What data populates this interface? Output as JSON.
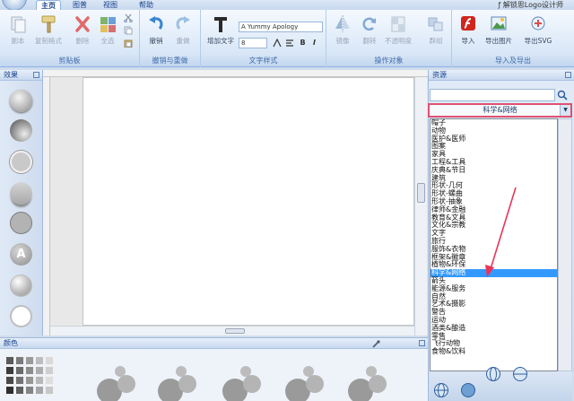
{
  "app": {
    "title": "ƒ 解锁思Logo设计师"
  },
  "tabs": [
    {
      "label": "主页",
      "active": true
    },
    {
      "label": "图普",
      "active": false
    },
    {
      "label": "视图",
      "active": false
    },
    {
      "label": "帮助",
      "active": false
    }
  ],
  "ribbon": {
    "clipboard": {
      "label": "剪贴板",
      "copy": "副本",
      "copy_format": "复制格式",
      "delete": "删除",
      "select_all": "全选"
    },
    "undo_redo": {
      "label": "撤销与重做",
      "undo": "撤销",
      "redo": "重做"
    },
    "text_style": {
      "label": "文字样式",
      "add_text": "增加文字",
      "font_name": "A Yummy Apology",
      "font_size": "8",
      "bold": "B",
      "italic": "I"
    },
    "actions": {
      "label": "操作对象",
      "mirror": "镜像",
      "rotate": "翻转",
      "opacity": "不透明度",
      "group": "群组"
    },
    "import_export": {
      "label": "导入及导出",
      "import": "导入",
      "export_image": "导出图片",
      "export_svg": "导出SVG"
    }
  },
  "effects_panel": {
    "title": "效果",
    "text_effect_glyph": "A"
  },
  "colors_panel": {
    "title": "颜色"
  },
  "resource_panel": {
    "title": "资源",
    "search_placeholder": "",
    "selected_category": "科学&网络",
    "categories": [
      "帽子",
      "动物",
      "医护&医师",
      "图案",
      "家具",
      "工程&工具",
      "庆典&节日",
      "建筑",
      "形状-几何",
      "形状-螺曲",
      "形状-抽象",
      "律师&金融",
      "教育&文具",
      "文化&宗教",
      "文字",
      "旅行",
      "服饰&衣物",
      "框架&徽章",
      "植物&环保",
      "科学&网络",
      "箭头",
      "能源&服务",
      "自然",
      "艺术&摄影",
      "警告",
      "运动",
      "酒类&酿造",
      "零售",
      "飞行动物",
      "食物&饮料"
    ]
  },
  "colors": {
    "accent_border": "#e05070",
    "selection": "#3399ff",
    "annotation_arrow": "#e8355a"
  }
}
